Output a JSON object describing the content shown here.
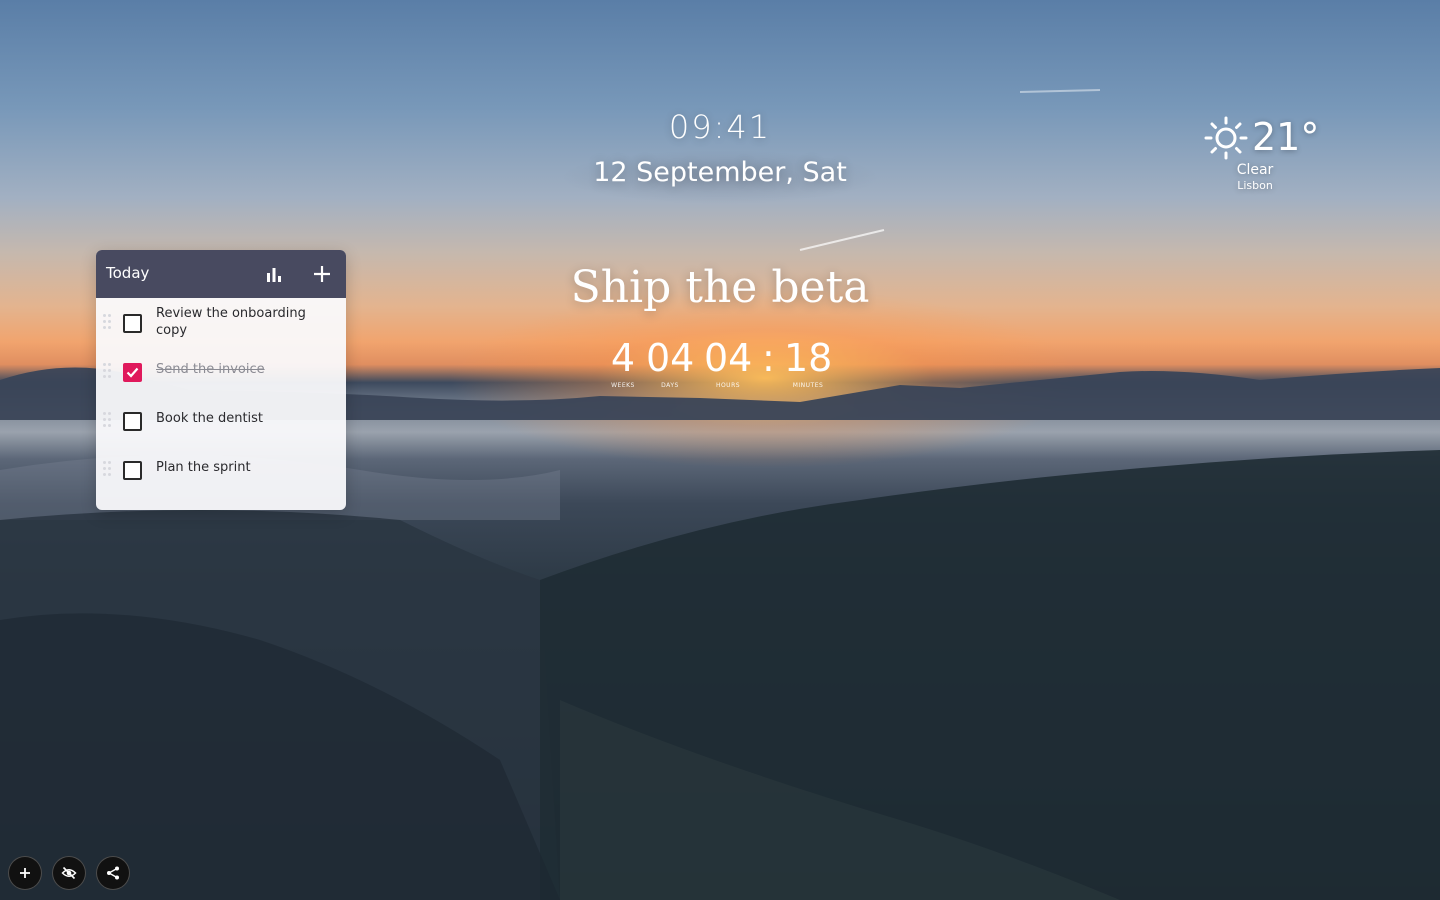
{
  "clock": {
    "time": "09:41",
    "date": "12 September, Sat"
  },
  "goal": {
    "title": "Ship the beta"
  },
  "countdown": {
    "units": [
      {
        "value": "4",
        "label": "WEEKS"
      },
      {
        "value": "04",
        "label": "DAYS"
      },
      {
        "value": "04",
        "label": "HOURS"
      },
      {
        "value": "18",
        "label": "MINUTES"
      }
    ],
    "separator": ":"
  },
  "weather": {
    "temperature": "21°",
    "condition": "Clear",
    "city": "Lisbon",
    "icon": "sun-icon"
  },
  "todo": {
    "title": "Today",
    "stats_icon": "bar-chart-icon",
    "add_icon": "plus-icon",
    "accent_color": "#e0195c",
    "header_color": "#484a60",
    "items": [
      {
        "text": "Review the onboarding copy",
        "done": false
      },
      {
        "text": "Send the invoice",
        "done": true
      },
      {
        "text": "Book the dentist",
        "done": false
      },
      {
        "text": "Plan the sprint",
        "done": false
      }
    ]
  },
  "toolbar": {
    "buttons": [
      {
        "name": "add-widget",
        "icon": "plus-icon"
      },
      {
        "name": "hide-widgets",
        "icon": "eye-off-icon"
      },
      {
        "name": "share",
        "icon": "share-icon"
      }
    ]
  }
}
